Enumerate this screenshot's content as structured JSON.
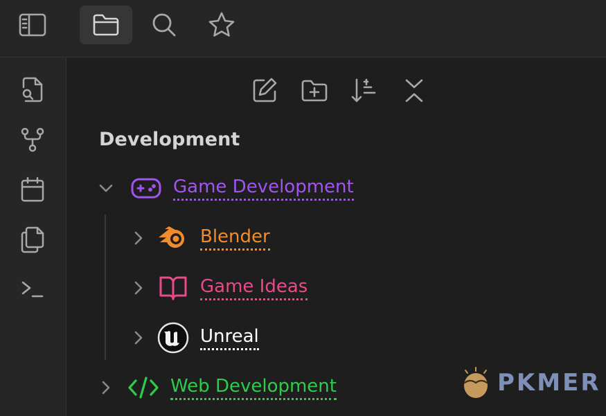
{
  "topbar": {
    "tabs": [
      {
        "icon": "sidebar-toggle-icon"
      },
      {
        "icon": "folder-icon",
        "active": true
      },
      {
        "icon": "search-icon"
      },
      {
        "icon": "star-icon"
      }
    ]
  },
  "ribbon": {
    "items": [
      {
        "icon": "file-search-icon"
      },
      {
        "icon": "graph-icon"
      },
      {
        "icon": "calendar-icon"
      },
      {
        "icon": "copy-icon"
      },
      {
        "icon": "terminal-icon"
      }
    ]
  },
  "explorer": {
    "toolbar": [
      {
        "icon": "new-note-icon"
      },
      {
        "icon": "new-folder-icon"
      },
      {
        "icon": "sort-icon"
      },
      {
        "icon": "collapse-all-icon"
      }
    ],
    "vault_name": "Development",
    "tree": [
      {
        "label": "Game Development",
        "color": "#a254f0",
        "icon": "gamepad-icon",
        "expanded": true,
        "depth": 0
      },
      {
        "label": "Blender",
        "color": "#f08c2e",
        "icon": "blender-icon",
        "expanded": false,
        "depth": 1
      },
      {
        "label": "Game Ideas",
        "color": "#e84a8a",
        "icon": "book-open-icon",
        "expanded": false,
        "depth": 1
      },
      {
        "label": "Unreal",
        "color": "#ffffff",
        "icon": "unreal-logo-icon",
        "expanded": false,
        "depth": 1
      },
      {
        "label": "Web Development",
        "color": "#2ecc4a",
        "icon": "code-icon",
        "expanded": false,
        "depth": 0
      }
    ]
  },
  "watermark": {
    "text": "PKMER"
  },
  "colors": {
    "icon_gray": "#a8a8a8",
    "active_tab_bg": "#363636",
    "panel_bg": "#262626",
    "pane_bg": "#1e1e1e"
  }
}
